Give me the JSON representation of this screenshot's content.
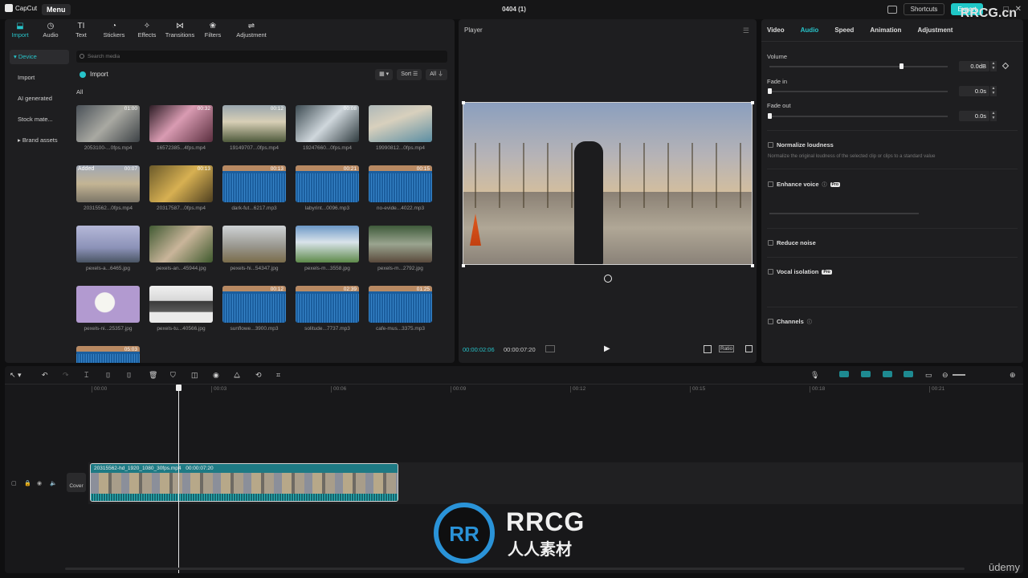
{
  "app": {
    "logo": "CapCut",
    "menu": "Menu",
    "title": "0404 (1)",
    "shortcuts": "Shortcuts",
    "export": "Export",
    "window_controls": [
      "—",
      "□",
      "✕"
    ]
  },
  "media_tabs": [
    {
      "label": "Import",
      "icon": "import-icon",
      "glyph": "⬓"
    },
    {
      "label": "Audio",
      "icon": "audio-icon",
      "glyph": "◷"
    },
    {
      "label": "Text",
      "icon": "text-icon",
      "glyph": "TI"
    },
    {
      "label": "Stickers",
      "icon": "stickers-icon",
      "glyph": "◔"
    },
    {
      "label": "Effects",
      "icon": "effects-icon",
      "glyph": "✧"
    },
    {
      "label": "Transitions",
      "icon": "transitions-icon",
      "glyph": "⋈"
    },
    {
      "label": "Filters",
      "icon": "filters-icon",
      "glyph": "❀"
    },
    {
      "label": "Adjustment",
      "icon": "adjustment-icon",
      "glyph": "⇌"
    }
  ],
  "side_nav": [
    "Device",
    "Import",
    "AI generated",
    "Stock mate...",
    "Brand assets"
  ],
  "search": {
    "placeholder": "Search media"
  },
  "import_label": "Import",
  "filter_buttons": [
    "▦ ▾",
    "Sort ☰",
    "All ⏚"
  ],
  "all_label": "All",
  "media": [
    {
      "name": "2053100-...0fps.mp4",
      "duration": "01:00",
      "kind": "video",
      "bg": "linear-gradient(135deg,#4a5158,#a9a9a2 50%,#3d4246)"
    },
    {
      "name": "16572385...4fps.mp4",
      "duration": "00:32",
      "kind": "video",
      "bg": "linear-gradient(135deg,#2d1d25,#d99bb2 45%,#5b2f3f)"
    },
    {
      "name": "19149707...0fps.mp4",
      "duration": "00:12",
      "kind": "video",
      "bg": "linear-gradient(180deg,#9aa6ae,#d8cfb6 45%,#4f5a3c)"
    },
    {
      "name": "19247660...0fps.mp4",
      "duration": "00:08",
      "kind": "video",
      "bg": "linear-gradient(135deg,#3d4b52,#cfd7dc 50%,#2f3b3f)"
    },
    {
      "name": "19990812...0fps.mp4",
      "duration": "",
      "kind": "video",
      "bg": "linear-gradient(160deg,#aeb8b8,#d8d0bd 40%,#5b8ea3)"
    },
    {
      "name": "20315562...0fps.mp4",
      "duration": "00:07",
      "kind": "video",
      "added": "Added",
      "bg": "linear-gradient(180deg,#9fa7b5,#c3b494 50%,#7c7668)"
    },
    {
      "name": "20317587...0fps.mp4",
      "duration": "00:13",
      "kind": "video",
      "bg": "linear-gradient(135deg,#6b5a2a,#d7b052 50%,#4f4020)"
    },
    {
      "name": "dark-fut...6217.mp3",
      "duration": "00:13",
      "kind": "audio"
    },
    {
      "name": "labyrint...0096.mp3",
      "duration": "00:21",
      "kind": "audio"
    },
    {
      "name": "no-evide...4022.mp3",
      "duration": "00:15",
      "kind": "audio"
    },
    {
      "name": "pexels-a...6465.jpg",
      "duration": "",
      "kind": "image",
      "bg": "linear-gradient(180deg,#b5b8d8,#8c92b8 60%,#4a5564)"
    },
    {
      "name": "pexels-an...45944.jpg",
      "duration": "",
      "kind": "image",
      "bg": "linear-gradient(135deg,#415a33,#c9b59a 50%,#405a2e)"
    },
    {
      "name": "pexels-hi...54347.jpg",
      "duration": "",
      "kind": "image",
      "bg": "linear-gradient(180deg,#cfd3d6,#9a9890 55%,#7a6c4a)"
    },
    {
      "name": "pexels-m...3558.jpg",
      "duration": "",
      "kind": "image",
      "bg": "linear-gradient(180deg,#6c98c7,#d9e3ea 45%,#5e8a4a)"
    },
    {
      "name": "pexels-m...2792.jpg",
      "duration": "",
      "kind": "image",
      "bg": "linear-gradient(180deg,#3e5a3a,#9aa48f 50%,#5a4a3c)"
    },
    {
      "name": "pexels-ni...25357.jpg",
      "duration": "",
      "kind": "image",
      "bg": "radial-gradient(circle at 45% 45%,#f5f5f0 0 12px,#b29ad0 13px)"
    },
    {
      "name": "pexels-tu...40566.jpg",
      "duration": "",
      "kind": "image",
      "bg": "linear-gradient(180deg,#f0f0f0,#d8d8d8 40%,#3a3a3a 42%,#5a5a5a 70%,#eaeaea 72%)"
    },
    {
      "name": "sunflowe...3900.mp3",
      "duration": "00:12",
      "kind": "audio"
    },
    {
      "name": "solitude...7737.mp3",
      "duration": "02:39",
      "kind": "audio"
    },
    {
      "name": "cafe-mus...3375.mp3",
      "duration": "01:25",
      "kind": "audio"
    },
    {
      "name": "",
      "duration": "05:03",
      "kind": "audio"
    }
  ],
  "player": {
    "title": "Player",
    "current_time": "00:00:02:06",
    "total_time": "00:00:07:20",
    "ratio": "Ratio"
  },
  "props": {
    "tabs": [
      "Video",
      "Audio",
      "Speed",
      "Animation",
      "Adjustment"
    ],
    "active_tab": "Audio",
    "volume": {
      "label": "Volume",
      "value": "0.0dB",
      "level": 0.74
    },
    "fade_in": {
      "label": "Fade in",
      "value": "0.0s",
      "level": 0.0
    },
    "fade_out": {
      "label": "Fade out",
      "value": "0.0s",
      "level": 0.0
    },
    "normalize": {
      "label": "Normalize loudness",
      "desc": "Normalize the original loudness of the selected clip or clips to a standard value"
    },
    "enhance_voice": "Enhance voice",
    "reduce_noise": "Reduce noise",
    "vocal_isolation": "Vocal isolation",
    "channels": "Channels",
    "pro_badge": "Pro"
  },
  "timeline": {
    "ruler": [
      "00:00",
      "00:03",
      "00:06",
      "00:09",
      "00:12",
      "00:15",
      "00:18",
      "00:21"
    ],
    "clip": {
      "name": "20315562-hd_1920_1080_30fps.mp4",
      "duration": "00:00:07:20"
    },
    "cover": "Cover"
  },
  "watermarks": {
    "rrcg": "RRCG",
    "rrcg_sub": "人人素材",
    "rrcg_logo": "RR",
    "corner": "RRCG.cn",
    "udemy": "ūdemy"
  },
  "colors": {
    "accent": "#27c3c9",
    "audio_clip": "#1b5e9e",
    "export": "#1fc7c7"
  }
}
